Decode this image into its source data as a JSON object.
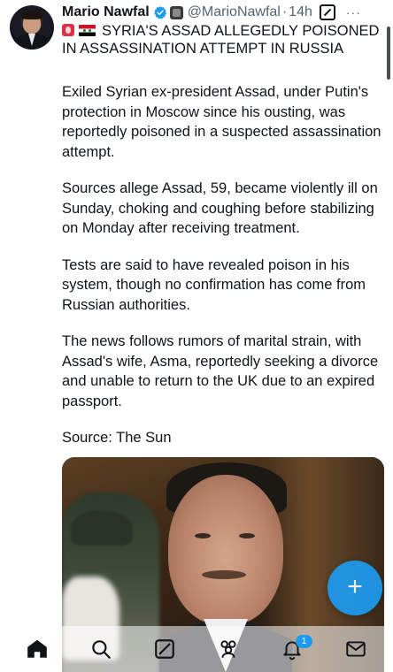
{
  "post": {
    "author_name": "Mario Nawfal",
    "handle": "@MarioNawfal",
    "separator": "·",
    "timestamp": "14h",
    "more_label": "···",
    "headline": "SYRIA'S ASSAD ALLEGEDLY POISONED IN ASSASSINATION ATTEMPT IN RUSSIA",
    "paragraphs": [
      "Exiled Syrian ex-president Assad, under Putin's protection in Moscow since his ousting, was reportedly poisoned in a suspected assassination attempt.",
      "Sources allege Assad, 59, became violently ill on Sunday, choking and coughing before stabilizing on Monday after receiving treatment.",
      "Tests are said to have revealed poison in his system, though no confirmation has come from Russian authorities.",
      "The news follows rumors of marital strain, with Assad's wife, Asma, reportedly seeking a divorce and unable to return to the UK due to an expired passport.",
      "Source: The Sun"
    ],
    "icons": {
      "verified": "verified-badge-icon",
      "affiliate": "affiliate-badge-icon",
      "grok": "grok-icon",
      "alert_emoji": "alert-emoji-icon",
      "flag_emoji": "syria-flag-icon"
    }
  },
  "fab": {
    "label": "+"
  },
  "bottom_nav": {
    "items": [
      "home-icon",
      "search-icon",
      "grok-icon",
      "communities-icon",
      "notifications-icon",
      "messages-icon"
    ],
    "notifications_count": "1"
  },
  "colors": {
    "accent": "#1d9bf0",
    "text": "#0f1419",
    "secondary_text": "#536471"
  }
}
